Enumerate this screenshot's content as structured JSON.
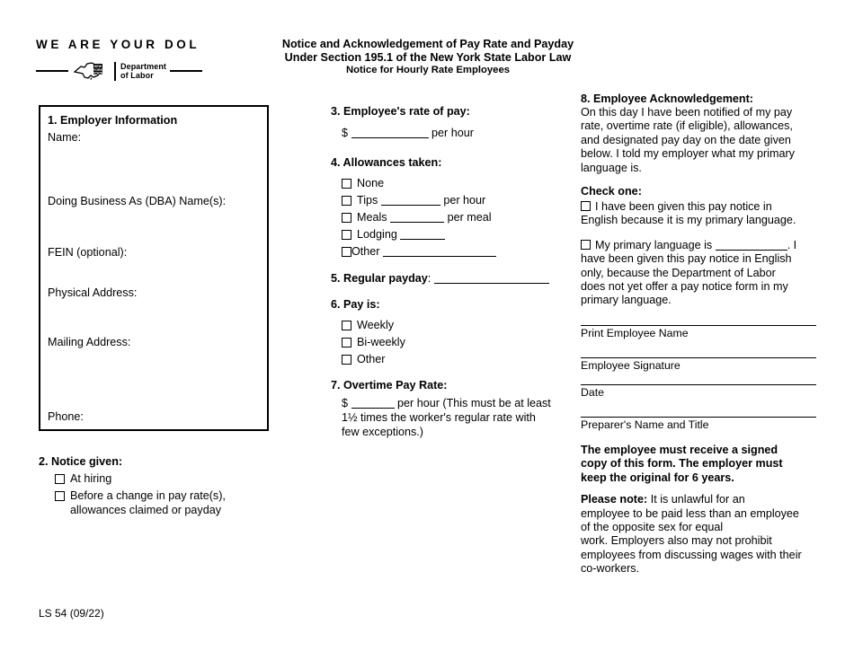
{
  "header": {
    "wordmark": "WE ARE YOUR DOL",
    "state_mark_lines": [
      "NEW",
      "YORK",
      "STATE"
    ],
    "department_line1": "Department",
    "department_line2": "of Labor",
    "title_line1": "Notice and Acknowledgement of Pay Rate and Payday",
    "title_line2": "Under Section 195.1 of the New York State Labor Law",
    "title_line3": "Notice for Hourly Rate Employees"
  },
  "employer_section": {
    "heading": "1. Employer Information",
    "fields": [
      {
        "label": "Name:"
      },
      {
        "label": "Doing Business As (DBA) Name(s):"
      },
      {
        "label": "FEIN (optional):"
      },
      {
        "label": "Physical Address:"
      },
      {
        "label": "Mailing Address:"
      },
      {
        "label": "Phone:"
      }
    ]
  },
  "notice_given": {
    "heading": "2. Notice given:",
    "options": [
      "At hiring",
      "Before a change in pay rate(s),",
      "allowances claimed or payday"
    ]
  },
  "rate_of_pay": {
    "heading": "3. Employee's rate of pay:",
    "currency": "$",
    "unit": "per hour"
  },
  "allowances": {
    "heading": "4. Allowances taken:",
    "options": [
      {
        "label": "None",
        "blank": false,
        "unit": ""
      },
      {
        "label": "Tips",
        "blank": true,
        "unit": "per hour"
      },
      {
        "label": "Meals",
        "blank": true,
        "unit": "per meal"
      },
      {
        "label": "Lodging",
        "blank": true,
        "unit": ""
      },
      {
        "label": "Other",
        "blank": true,
        "unit": ""
      }
    ]
  },
  "regular_payday": {
    "heading": "5. Regular payday",
    "colon": ":"
  },
  "pay_is": {
    "heading": "6. Pay is:",
    "options": [
      "Weekly",
      "Bi-weekly",
      "Other"
    ]
  },
  "overtime": {
    "heading": "7. Overtime Pay Rate:",
    "currency": "$",
    "text_after_blank": "per hour (This must be at least",
    "line2": "1½ times the worker's regular rate with",
    "line3": "few exceptions.)"
  },
  "acknowledgement": {
    "heading": "8. Employee Acknowledgement:",
    "body_lines": [
      "On this day I have been notified of my pay",
      "rate, overtime rate (if eligible), allowances,",
      "and designated pay day on the date given",
      "below.  I told my employer what my primary",
      "language is."
    ],
    "check_one_label": "Check one:",
    "option1_lines": [
      "I have been given this pay notice in",
      "English because it is my primary language."
    ],
    "option2_prefix": "My primary language is",
    "option2_after_blank": ".  I",
    "option2_lines": [
      "have been given this pay notice in English",
      "only, because the Department of Labor",
      "does not yet offer a pay notice form in my",
      "primary language."
    ],
    "signature_lines": [
      "Print Employee Name",
      "Employee Signature",
      "Date",
      "Preparer's Name and Title"
    ],
    "bold_note_lines": [
      "The employee must receive a signed",
      "copy of this form. The employer must",
      "keep the original for 6 years."
    ],
    "please_note_label": "Please note:",
    "please_note_lines": [
      " It is unlawful for an",
      "employee to be paid less than an employee",
      "of the opposite sex for equal",
      "work. Employers also may not prohibit",
      "employees from discussing wages with their",
      "co-workers."
    ]
  },
  "footer": {
    "form_code": "LS 54 (09/22)"
  },
  "colors": {
    "ink": "#000000",
    "paper": "#ffffff"
  }
}
